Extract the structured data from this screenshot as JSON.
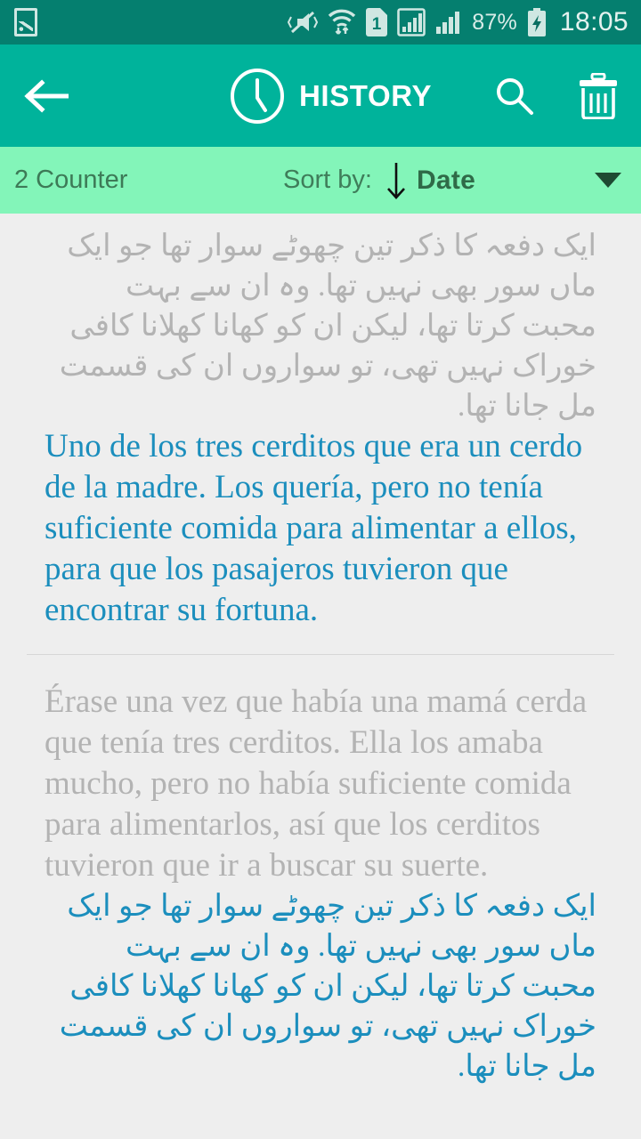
{
  "status_bar": {
    "gallery_icon": "gallery-icon",
    "vibrate_mute_icon": "vibrate-mute-icon",
    "wifi_icon": "wifi-transfer-icon",
    "sim_icon": "sim-1-icon",
    "signal_1_icon": "signal-bars-boxed-icon",
    "signal_2_icon": "signal-bars-icon",
    "battery_percent": "87%",
    "battery_icon": "battery-charging-icon",
    "time": "18:05"
  },
  "app_bar": {
    "back_icon": "back-arrow-icon",
    "clock_icon": "clock-icon",
    "title": "HISTORY",
    "search_icon": "search-icon",
    "delete_icon": "trash-icon"
  },
  "sort_bar": {
    "counter": "2 Counter",
    "sort_by_label": "Sort by:",
    "sort_direction_icon": "arrow-down-icon",
    "sort_value": "Date",
    "dropdown_icon": "chevron-down-icon"
  },
  "colors": {
    "status_bar": "#057f6f",
    "app_bar": "#00b39b",
    "sort_bar": "#83f5b9",
    "page_background": "#eeeeee",
    "source_text": "#b3b3b3",
    "target_text": "#1b8ebd",
    "divider": "#d6d6d6"
  },
  "history_items": [
    {
      "source_text": "ایک دفعہ کا ذکر تین چھوٹے سوار تھا جو ایک ماں سور بھی نہیں تھا. وہ ان سے بہت محبت کرتا تھا، لیکن ان کو کھانا کھلانا کافی خوراک نہیں تھی، تو سواروں ان کی قسمت مل جانا تھا.",
      "source_rtl": true,
      "target_text": "Uno de los tres cerditos que era un cerdo de la madre. Los quería, pero no tenía suficiente comida para alimentar a ellos, para que los pasajeros tuvieron que encontrar su fortuna.",
      "target_rtl": false
    },
    {
      "source_text": "Érase una vez que había una mamá cerda que tenía tres cerditos. Ella los amaba mucho, pero no había suficiente comida para alimentarlos, así que los cerditos tuvieron que ir a buscar su suerte.",
      "source_rtl": false,
      "target_text": "ایک دفعہ کا ذکر تین چھوٹے سوار تھا جو ایک ماں سور بھی نہیں تھا. وہ ان سے بہت محبت کرتا تھا، لیکن ان کو کھانا کھلانا کافی خوراک نہیں تھی، تو سواروں ان کی قسمت مل جانا تھا.",
      "target_rtl": true
    }
  ]
}
